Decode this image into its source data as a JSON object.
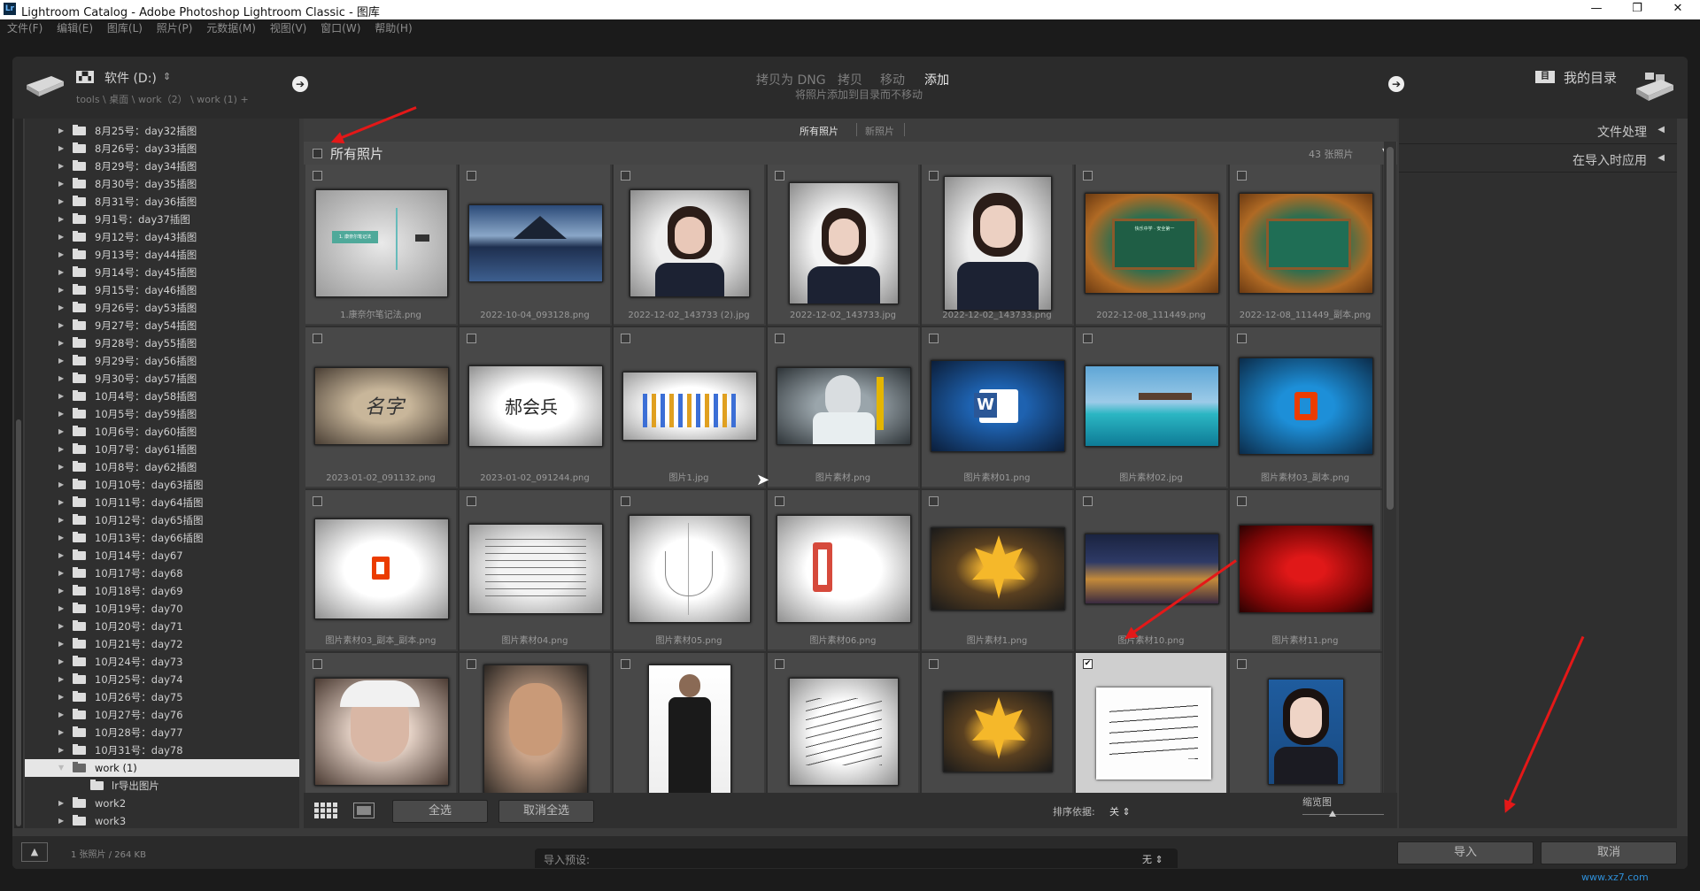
{
  "window": {
    "app_icon": "Lr",
    "title": "Lightroom Catalog - Adobe Photoshop Lightroom Classic - 图库",
    "minimize_icon": "—",
    "maximize_icon": "❐",
    "close_icon": "✕"
  },
  "menu": [
    "文件(F)",
    "编辑(E)",
    "图库(L)",
    "照片(P)",
    "元数据(M)",
    "视图(V)",
    "窗口(W)",
    "帮助(H)"
  ],
  "source": {
    "drive_label": "软件 (D:)",
    "drive_caret": "⇕",
    "path": "tools \\ 桌面 \\ work（2） \\ work (1) +"
  },
  "modes": {
    "items": [
      "拷贝为 DNG",
      "拷贝",
      "移动",
      "添加"
    ],
    "active": "添加",
    "description": "将照片添加到目录而不移动"
  },
  "destination": {
    "label": "我的目录"
  },
  "folders": [
    "8月25号：day32插图",
    "8月26号：day33插图",
    "8月29号：day34插图",
    "8月30号：day35插图",
    "8月31号：day36插图",
    "9月1号：day37插图",
    "9月12号：day43插图",
    "9月13号：day44插图",
    "9月14号：day45插图",
    "9月15号：day46插图",
    "9月26号：day53插图",
    "9月27号：day54插图",
    "9月28号：day55插图",
    "9月29号：day56插图",
    "9月30号：day57插图",
    "10月4号：day58插图",
    "10月5号：day59插图",
    "10月6号：day60插图",
    "10月7号：day61插图",
    "10月8号：day62插图",
    "10月10号：day63插图",
    "10月11号：day64插图",
    "10月12号：day65插图",
    "10月13号：day66插图",
    "10月14号：day67",
    "10月17号：day68",
    "10月18号：day69",
    "10月19号：day70",
    "10月20号：day71",
    "10月21号：day72",
    "10月24号：day73",
    "10月25号：day74",
    "10月26号：day75",
    "10月27号：day76",
    "10月28号：day77",
    "10月31号：day78",
    "work (1)",
    "lr导出图片",
    "work2",
    "work3"
  ],
  "view_tabs": [
    "所有照片",
    "新照片"
  ],
  "all_photos": {
    "label": "所有照片",
    "count": "43 张照片",
    "menu_icon": "▼"
  },
  "photos": [
    {
      "name": "1.康奈尔笔记法.png",
      "checked": false
    },
    {
      "name": "2022-10-04_093128.png",
      "checked": false
    },
    {
      "name": "2022-12-02_143733 (2).jpg",
      "checked": false
    },
    {
      "name": "2022-12-02_143733.jpg",
      "checked": false
    },
    {
      "name": "2022-12-02_143733.png",
      "checked": false
    },
    {
      "name": "2022-12-08_111449.png",
      "checked": false
    },
    {
      "name": "2022-12-08_111449_副本.png",
      "checked": false
    },
    {
      "name": "2023-01-02_091132.png",
      "checked": false
    },
    {
      "name": "2023-01-02_091244.png",
      "checked": false
    },
    {
      "name": "图片1.jpg",
      "checked": false
    },
    {
      "name": "图片素材.png",
      "checked": false
    },
    {
      "name": "图片素材01.png",
      "checked": false
    },
    {
      "name": "图片素材02.jpg",
      "checked": false
    },
    {
      "name": "图片素材03_副本.png",
      "checked": false
    },
    {
      "name": "图片素材03_副本_副本.png",
      "checked": false
    },
    {
      "name": "图片素材04.png",
      "checked": false
    },
    {
      "name": "图片素材05.png",
      "checked": false
    },
    {
      "name": "图片素材06.png",
      "checked": false
    },
    {
      "name": "图片素材1.png",
      "checked": false
    },
    {
      "name": "图片素材10.png",
      "checked": false
    },
    {
      "name": "图片素材11.png",
      "checked": false
    },
    {
      "name": "",
      "checked": false
    },
    {
      "name": "",
      "checked": false
    },
    {
      "name": "",
      "checked": false
    },
    {
      "name": "",
      "checked": false
    },
    {
      "name": "",
      "checked": false
    },
    {
      "name": "",
      "checked": true
    },
    {
      "name": "",
      "checked": false
    }
  ],
  "thumb_text": {
    "mindmap": "1. 康奈尔笔记法",
    "sig1": "名字",
    "sig2": "郝会兵",
    "chalkboard": "快乐中学 · 安全第一",
    "word": "W"
  },
  "toolbar": {
    "select_all": "全选",
    "deselect_all": "取消全选",
    "sort_label": "排序依据:",
    "sort_value": "关 ⇕",
    "thumb_label": "缩览图"
  },
  "right_panel": {
    "file_handling": "文件处理",
    "apply_during_import": "在导入时应用",
    "collapse_icon": "◀"
  },
  "status": {
    "summary": "1 张照片 / 264 KB",
    "preset_label": "导入预设:",
    "preset_value": "无 ⇕",
    "import_button": "导入",
    "cancel_button": "取消"
  },
  "watermark": "www.xz7.com",
  "accent_color": "#e41818"
}
